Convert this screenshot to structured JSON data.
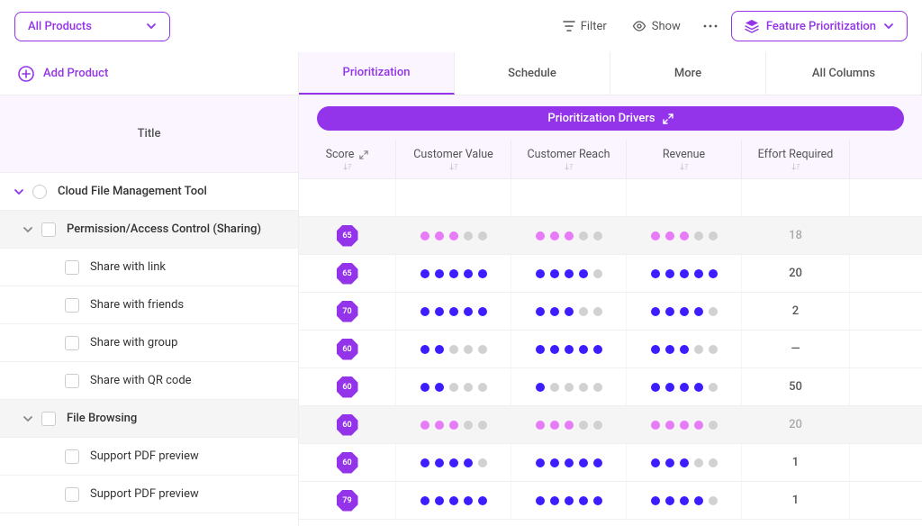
{
  "topbar": {
    "product_selector_label": "All Products",
    "filter_label": "Filter",
    "show_label": "Show",
    "feature_prioritization_label": "Feature Prioritization"
  },
  "left": {
    "add_product_label": "Add Product",
    "title_header": "Title"
  },
  "tabs": [
    {
      "label": "Prioritization",
      "active": true
    },
    {
      "label": "Schedule",
      "active": false
    },
    {
      "label": "More",
      "active": false
    },
    {
      "label": "All Columns",
      "active": false
    }
  ],
  "drivers_bar": "Prioritization Drivers",
  "columns": {
    "score": "Score",
    "customer_value": "Customer Value",
    "customer_reach": "Customer Reach",
    "revenue": "Revenue",
    "effort_required": "Effort Required"
  },
  "rows": [
    {
      "type": "parent",
      "label": "Cloud File Management Tool"
    },
    {
      "type": "feature",
      "label": "Permission/Access Control (Sharing)",
      "score": "65",
      "dot_color": "pink",
      "metrics": [
        3,
        3,
        3
      ],
      "effort": "18",
      "effort_gray": true
    },
    {
      "type": "item",
      "label": "Share with link",
      "score": "65",
      "dot_color": "blue",
      "metrics": [
        5,
        4,
        5
      ],
      "effort": "20"
    },
    {
      "type": "item",
      "label": "Share with friends",
      "score": "70",
      "dot_color": "blue",
      "metrics": [
        5,
        3,
        4
      ],
      "effort": "2"
    },
    {
      "type": "item",
      "label": "Share with group",
      "score": "60",
      "dot_color": "blue",
      "metrics": [
        2,
        5,
        3
      ],
      "effort": "—"
    },
    {
      "type": "item",
      "label": "Share with QR code",
      "score": "60",
      "dot_color": "blue",
      "metrics": [
        2,
        1,
        4
      ],
      "effort": "50"
    },
    {
      "type": "feature",
      "label": "File Browsing",
      "score": "60",
      "dot_color": "pink",
      "metrics": [
        3,
        3,
        4
      ],
      "effort": "20",
      "effort_gray": true
    },
    {
      "type": "item",
      "label": "Support PDF preview",
      "score": "60",
      "dot_color": "blue",
      "metrics": [
        4,
        5,
        3
      ],
      "effort": "1"
    },
    {
      "type": "item",
      "label": "Support PDF preview",
      "score": "79",
      "dot_color": "blue",
      "metrics": [
        5,
        5,
        4
      ],
      "effort": "1"
    }
  ]
}
